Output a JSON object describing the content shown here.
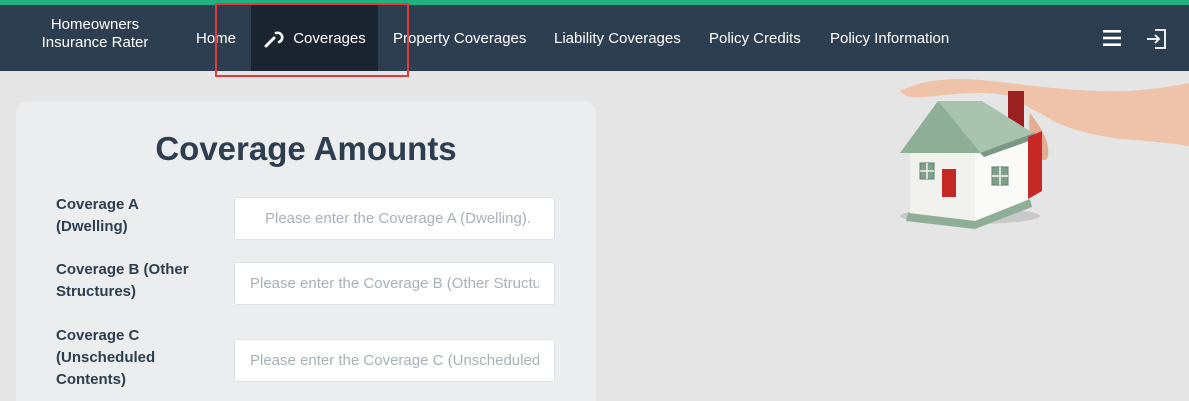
{
  "brand": {
    "line1": "Homeowners",
    "line2": "Insurance Rater"
  },
  "nav": {
    "items": [
      {
        "label": "Home"
      },
      {
        "label": "Coverages",
        "icon": "wrench-icon",
        "active": true
      },
      {
        "label": "Property Coverages"
      },
      {
        "label": "Liability Coverages"
      },
      {
        "label": "Policy Credits"
      },
      {
        "label": "Policy Information"
      }
    ],
    "right_icons": [
      "menu-icon",
      "exit-icon"
    ]
  },
  "form": {
    "title": "Coverage Amounts",
    "fields": [
      {
        "label_line1": "Coverage A",
        "label_line2": "(Dwelling)",
        "value": "",
        "placeholder": "Please enter the Coverage A (Dwelling)."
      },
      {
        "label_line1": "Coverage B (Other",
        "label_line2": "Structures)",
        "value": "",
        "placeholder": "Please enter the Coverage B (Other Structures)."
      },
      {
        "label_line1": "Coverage C",
        "label_line2": "(Unscheduled",
        "label_line3": "Contents)",
        "value": "",
        "placeholder": "Please enter the Coverage C (Unscheduled Contents)."
      }
    ]
  },
  "colors": {
    "accent": "#1fb17f",
    "navbar": "#2c3e50",
    "nav_active": "#1b2532",
    "highlight": "#e23c3c",
    "text_dark": "#2c3e50"
  }
}
